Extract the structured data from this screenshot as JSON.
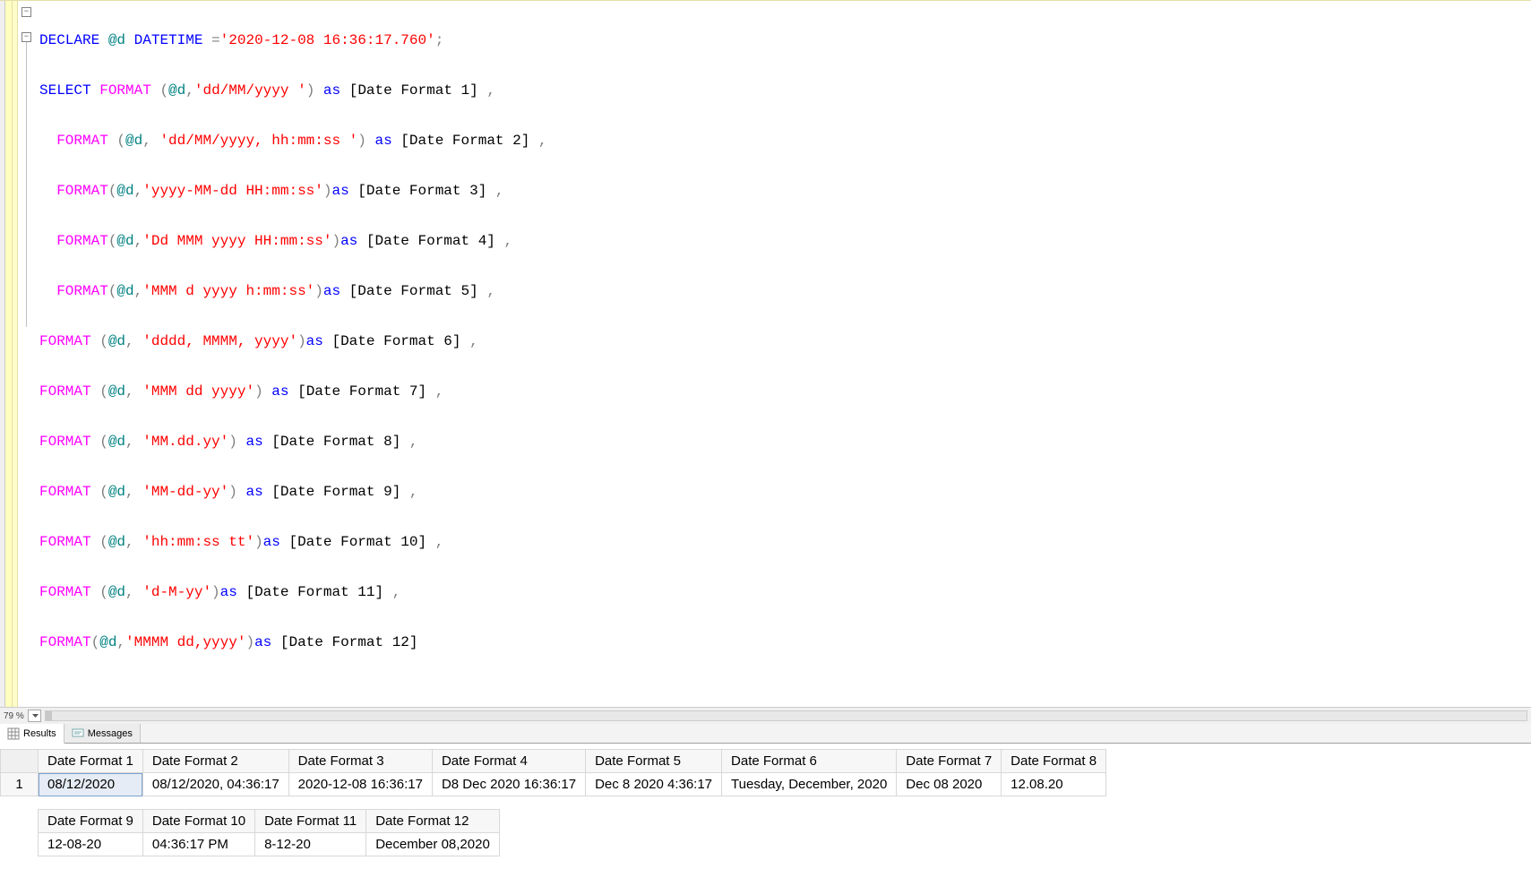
{
  "zoom": {
    "value": "79 %"
  },
  "tabs": {
    "results": "Results",
    "messages": "Messages"
  },
  "code": {
    "l1": {
      "declare": "DECLARE",
      "var": "@d",
      "type": "DATETIME",
      "eq": " =",
      "str": "'2020-12-08 16:36:17.760'",
      "semi": ";"
    },
    "l2": {
      "select": "SELECT",
      "fmt": "FORMAT ",
      "open": "(",
      "var": "@d",
      "comma": ",",
      "str": "'dd/MM/yyyy '",
      "close": ")",
      "as": " as",
      "alias": " [Date Format 1] ",
      "trail": ","
    },
    "l3": {
      "indent": "  ",
      "fmt": "FORMAT ",
      "open": "(",
      "var": "@d",
      "comma": ", ",
      "str": "'dd/MM/yyyy, hh:mm:ss '",
      "close": ")",
      "as": " as",
      "alias": " [Date Format 2] ",
      "trail": ","
    },
    "l4": {
      "indent": "  ",
      "fmt": "FORMAT",
      "open": "(",
      "var": "@d",
      "comma": ",",
      "str": "'yyyy-MM-dd HH:mm:ss'",
      "close": ")",
      "as": "as",
      "alias": " [Date Format 3] ",
      "trail": ","
    },
    "l5": {
      "indent": "  ",
      "fmt": "FORMAT",
      "open": "(",
      "var": "@d",
      "comma": ",",
      "str": "'Dd MMM yyyy HH:mm:ss'",
      "close": ")",
      "as": "as",
      "alias": " [Date Format 4] ",
      "trail": ","
    },
    "l6": {
      "indent": "  ",
      "fmt": "FORMAT",
      "open": "(",
      "var": "@d",
      "comma": ",",
      "str": "'MMM d yyyy h:mm:ss'",
      "close": ")",
      "as": "as",
      "alias": " [Date Format 5] ",
      "trail": ","
    },
    "l7": {
      "fmt": "FORMAT ",
      "open": "(",
      "var": "@d",
      "comma": ", ",
      "str": "'dddd, MMMM, yyyy'",
      "close": ")",
      "as": "as",
      "alias": " [Date Format 6] ",
      "trail": ","
    },
    "l8": {
      "fmt": "FORMAT ",
      "open": "(",
      "var": "@d",
      "comma": ", ",
      "str": "'MMM dd yyyy'",
      "close": ")",
      "as": " as",
      "alias": " [Date Format 7] ",
      "trail": ","
    },
    "l9": {
      "fmt": "FORMAT ",
      "open": "(",
      "var": "@d",
      "comma": ", ",
      "str": "'MM.dd.yy'",
      "close": ")",
      "as": " as",
      "alias": " [Date Format 8] ",
      "trail": ","
    },
    "l10": {
      "fmt": "FORMAT ",
      "open": "(",
      "var": "@d",
      "comma": ", ",
      "str": "'MM-dd-yy'",
      "close": ")",
      "as": " as",
      "alias": " [Date Format 9] ",
      "trail": ","
    },
    "l11": {
      "fmt": "FORMAT ",
      "open": "(",
      "var": "@d",
      "comma": ", ",
      "str": "'hh:mm:ss tt'",
      "close": ")",
      "as": "as",
      "alias": " [Date Format 10] ",
      "trail": ","
    },
    "l12": {
      "fmt": "FORMAT ",
      "open": "(",
      "var": "@d",
      "comma": ", ",
      "str": "'d-M-yy'",
      "close": ")",
      "as": "as",
      "alias": " [Date Format 11] ",
      "trail": ","
    },
    "l13": {
      "fmt": "FORMAT",
      "open": "(",
      "var": "@d",
      "comma": ",",
      "str": "'MMMM dd,yyyy'",
      "close": ")",
      "as": "as",
      "alias": " [Date Format 12]"
    }
  },
  "results": {
    "row_number": "1",
    "table1": {
      "headers": [
        "Date Format 1",
        "Date Format 2",
        "Date Format 3",
        "Date Format 4",
        "Date Format 5",
        "Date Format 6",
        "Date Format 7",
        "Date Format 8"
      ],
      "row": [
        "08/12/2020",
        "08/12/2020, 04:36:17",
        "2020-12-08 16:36:17",
        "D8 Dec 2020 16:36:17",
        "Dec 8 2020 4:36:17",
        "Tuesday, December, 2020",
        "Dec 08 2020",
        "12.08.20"
      ]
    },
    "table2": {
      "headers": [
        "Date Format 9",
        "Date Format 10",
        "Date Format 11",
        "Date Format 12"
      ],
      "row": [
        "12-08-20",
        "04:36:17 PM",
        "8-12-20",
        "December 08,2020"
      ]
    }
  }
}
